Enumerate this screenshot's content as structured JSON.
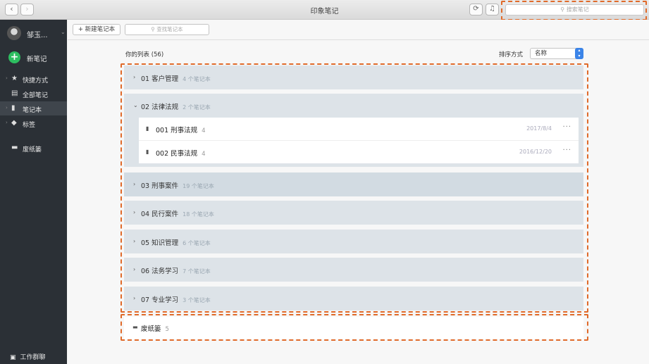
{
  "app": {
    "title": "印象笔记",
    "search_placeholder": "搜索笔记",
    "search_icon": "search-icon",
    "back_icon": "chevron-left-icon",
    "forward_icon": "chevron-right-icon",
    "sync_icon": "sync-icon",
    "bell_icon": "bell-icon"
  },
  "sidebar": {
    "user_name": "邹玉...",
    "new_note_label": "新笔记",
    "items": [
      {
        "label": "快捷方式",
        "icon": "star-icon"
      },
      {
        "label": "全部笔记",
        "icon": "note-icon"
      },
      {
        "label": "笔记本",
        "icon": "notebook-icon"
      },
      {
        "label": "标签",
        "icon": "tag-icon"
      },
      {
        "label": "废纸篓",
        "icon": "trash-icon"
      }
    ],
    "work_chat_label": "工作群聊"
  },
  "toolbar": {
    "new_notebook_label": "新建笔记本",
    "find_notebook_placeholder": "查找笔记本"
  },
  "main": {
    "list_count": "你的列表 (56)",
    "sort_label": "排序方式",
    "sort_value": "名称",
    "stacks": [
      {
        "name": "01 客户管理",
        "count": "4 个笔记本"
      },
      {
        "name": "02 法律法规",
        "count": "2 个笔记本",
        "notebooks": [
          {
            "name": "001 刑事法规",
            "count": "4",
            "date": "2017/8/4"
          },
          {
            "name": "002 民事法规",
            "count": "4",
            "date": "2016/12/20"
          }
        ]
      },
      {
        "name": "03 刑事案件",
        "count": "19 个笔记本"
      },
      {
        "name": "04 民行案件",
        "count": "18 个笔记本"
      },
      {
        "name": "05 知识管理",
        "count": "6 个笔记本"
      },
      {
        "name": "06 法务学习",
        "count": "7 个笔记本"
      },
      {
        "name": "07 专业学习",
        "count": "3 个笔记本"
      }
    ],
    "trash": {
      "name": "废纸篓",
      "count": "5"
    }
  },
  "colors": {
    "sidebar_bg": "#2b3036",
    "accent_green": "#2dbe60",
    "highlight": "#e06a2a",
    "stack_bg": "#dde3e8"
  }
}
